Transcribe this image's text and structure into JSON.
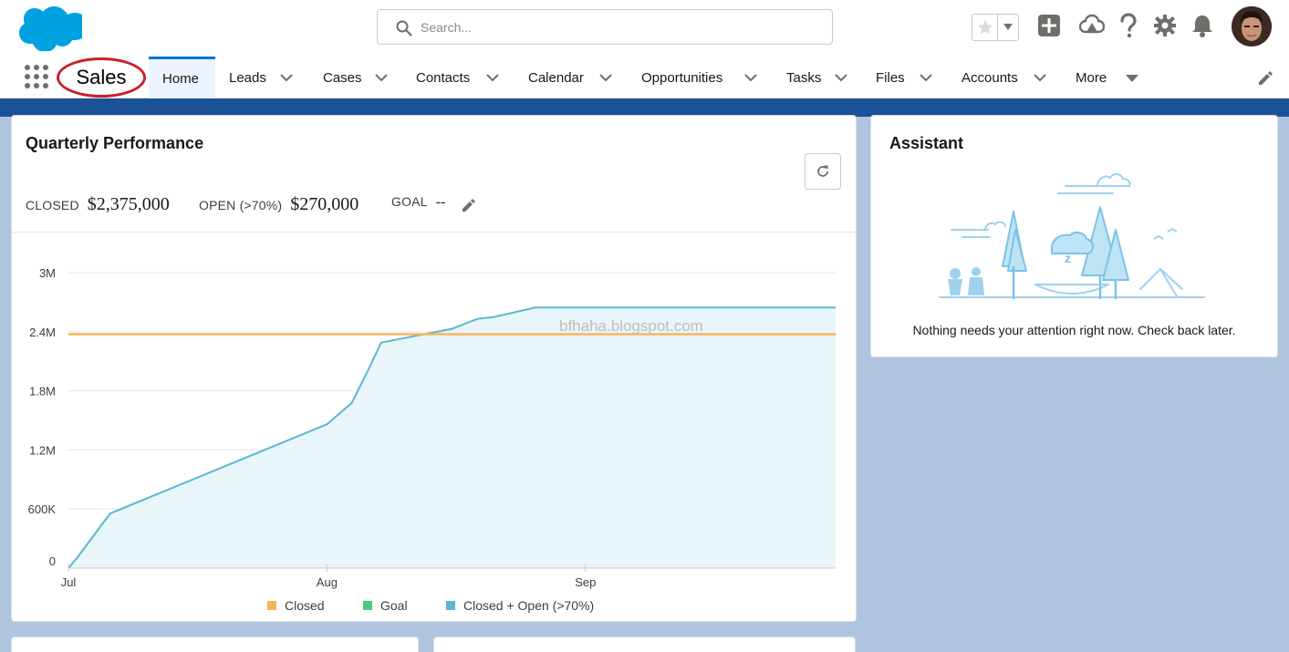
{
  "header": {
    "search_placeholder": "Search...",
    "icons": [
      "salesforce-cloud-logo",
      "star-icon",
      "chevron-down-icon",
      "add-icon",
      "trailhead-icon",
      "help-icon",
      "gear-icon",
      "bell-icon",
      "user-avatar"
    ]
  },
  "nav": {
    "app_name": "Sales",
    "items": [
      {
        "label": "Home",
        "active": true
      },
      {
        "label": "Leads"
      },
      {
        "label": "Cases"
      },
      {
        "label": "Contacts"
      },
      {
        "label": "Calendar"
      },
      {
        "label": "Opportunities"
      },
      {
        "label": "Tasks"
      },
      {
        "label": "Files"
      },
      {
        "label": "Accounts"
      },
      {
        "label": "More"
      }
    ]
  },
  "performance": {
    "title": "Quarterly Performance",
    "closed_label": "CLOSED",
    "closed_value": "$2,375,000",
    "open_label": "OPEN (>70%)",
    "open_value": "$270,000",
    "goal_label": "GOAL",
    "goal_value": "--",
    "watermark": "bfhaha.blogspot.com"
  },
  "chart_data": {
    "type": "area",
    "title": "",
    "xlabel": "",
    "ylabel": "",
    "x_ticks": [
      "Jul",
      "Aug",
      "Sep"
    ],
    "y_ticks": [
      "0",
      "600K",
      "1.2M",
      "1.8M",
      "2.4M",
      "3M"
    ],
    "ylim": [
      0,
      3000000
    ],
    "x_range_days": [
      0,
      92
    ],
    "legend": [
      "Closed",
      "Goal",
      "Closed + Open (>70%)"
    ],
    "legend_placement": "bottom",
    "grid": true,
    "series": [
      {
        "name": "Closed",
        "color": "#f7b55a",
        "type": "line",
        "x_days": [
          0,
          92
        ],
        "values": [
          2375000,
          2375000
        ]
      },
      {
        "name": "Closed + Open (>70%)",
        "color": "#5ab7d0",
        "type": "area",
        "x_days": [
          0,
          1,
          5,
          31,
          34,
          36,
          37.5,
          46,
          49,
          51,
          56,
          58,
          92
        ],
        "values": [
          0,
          100000,
          555000,
          1460000,
          1680000,
          2020000,
          2290000,
          2430000,
          2530000,
          2550000,
          2645000,
          2645000,
          2645000
        ]
      }
    ],
    "goal_series_color": "#4bca81"
  },
  "assistant": {
    "title": "Assistant",
    "message": "Nothing needs your attention right now. Check back later."
  }
}
